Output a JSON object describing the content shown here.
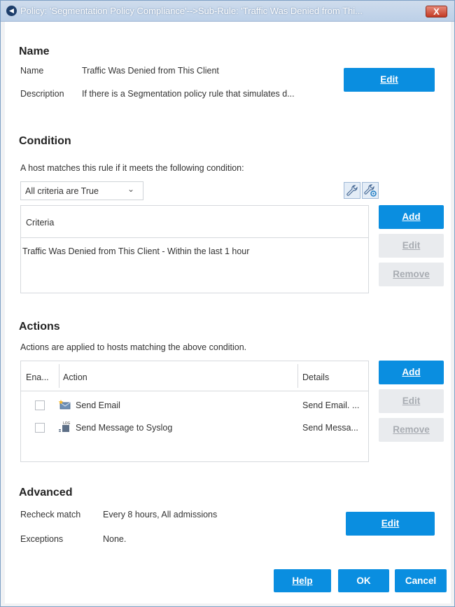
{
  "window": {
    "title": "Policy: 'Segmentation Policy Compliance'-->Sub-Rule: 'Traffic Was Denied from Thi...",
    "close_label": "X"
  },
  "name_section": {
    "title": "Name",
    "name_label": "Name",
    "name_value": "Traffic Was Denied from This Client",
    "description_label": "Description",
    "description_value": "If there is a Segmentation policy rule that simulates d...",
    "edit_label": "Edit"
  },
  "condition_section": {
    "title": "Condition",
    "instruction": "A host matches this rule if it meets the following condition:",
    "dropdown_value": "All criteria are True",
    "table_header": "Criteria",
    "rows": [
      "Traffic Was Denied from This Client - Within the last 1 hour"
    ],
    "add_label": "Add",
    "edit_label": "Edit",
    "remove_label": "Remove"
  },
  "actions_section": {
    "title": "Actions",
    "instruction": "Actions are applied to hosts matching the above condition.",
    "columns": {
      "enabled": "Ena...",
      "action": "Action",
      "details": "Details"
    },
    "rows": [
      {
        "action": "Send Email",
        "details": "Send Email. ...",
        "icon": "email-icon"
      },
      {
        "action": "Send Message to Syslog",
        "details": "Send Messa...",
        "icon": "syslog-icon"
      }
    ],
    "add_label": "Add",
    "edit_label": "Edit",
    "remove_label": "Remove"
  },
  "advanced_section": {
    "title": "Advanced",
    "recheck_label": "Recheck match",
    "recheck_value": "Every 8 hours, All admissions",
    "exceptions_label": "Exceptions",
    "exceptions_value": "None.",
    "edit_label": "Edit"
  },
  "footer": {
    "help_label": "Help",
    "ok_label": "OK",
    "cancel_label": "Cancel"
  },
  "colors": {
    "primary_button": "#0a8ee0",
    "disabled_button": "#e9ebee",
    "title_bar": "#bcd0e8",
    "close_button": "#c33b25"
  }
}
